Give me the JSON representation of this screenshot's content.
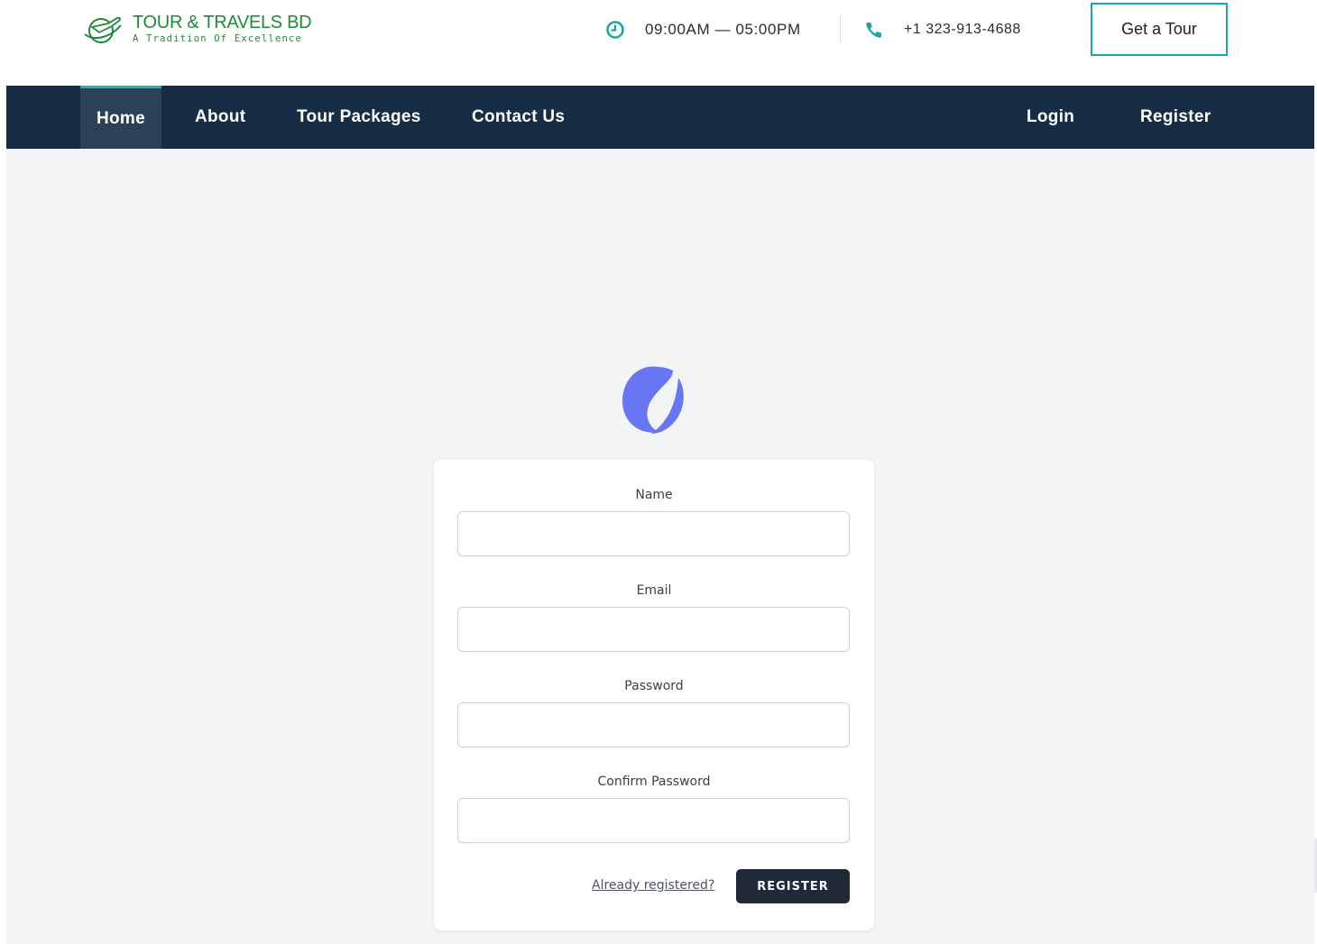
{
  "header": {
    "logo_title": "TOUR & TRAVELS BD",
    "logo_tagline": "A Tradition Of Excellence",
    "hours_text": "09:00AM — 05:00PM",
    "phone_text": "+1 323-913-4688",
    "cta_label": "Get a Tour",
    "accent_color": "#1aa7a0",
    "logo_color": "#1f8a3a"
  },
  "nav": {
    "background": "#172d45",
    "items": [
      {
        "label": "Home",
        "active": true
      },
      {
        "label": "About"
      },
      {
        "label": "Tour Packages"
      },
      {
        "label": "Contact Us"
      }
    ],
    "login_label": "Login",
    "register_label": "Register"
  },
  "form": {
    "brand_icon": "app-logo-icon",
    "brand_color": "#6875f5",
    "fields": [
      {
        "label": "Name",
        "value": ""
      },
      {
        "label": "Email",
        "value": ""
      },
      {
        "label": "Password",
        "value": ""
      },
      {
        "label": "Confirm Password",
        "value": ""
      }
    ],
    "already_link": "Already registered?",
    "submit_label": "REGISTER"
  }
}
